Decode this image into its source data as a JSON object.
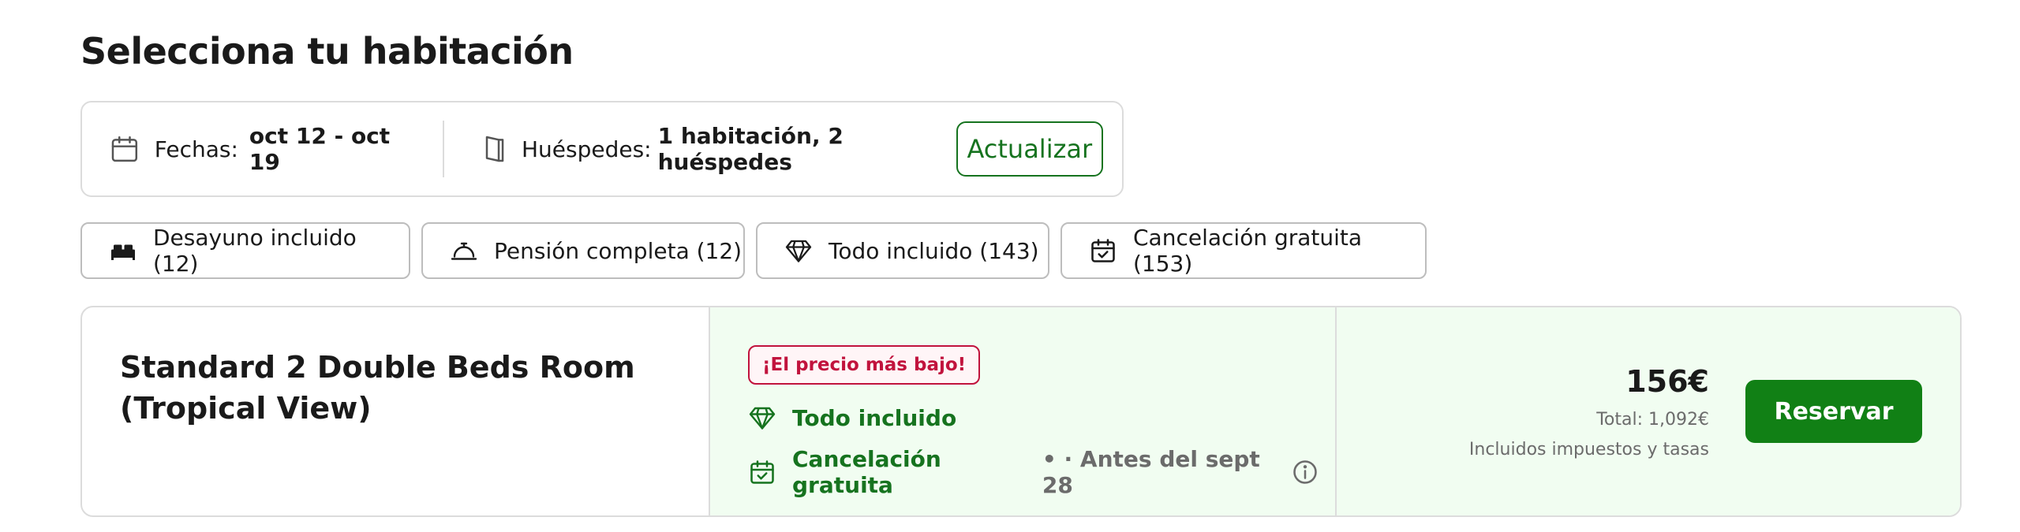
{
  "page": {
    "title": "Selecciona tu habitación"
  },
  "search": {
    "dates_label": "Fechas:",
    "dates_value": "oct 12 - oct 19",
    "guests_label": "Huéspedes:",
    "guests_value": "1 habitación, 2 huéspedes",
    "update_label": "Actualizar"
  },
  "filters": [
    {
      "label": "Desayuno incluido (12)",
      "icon": "bed-icon"
    },
    {
      "label": "Pensión completa (12)",
      "icon": "cloche-icon"
    },
    {
      "label": "Todo incluido (143)",
      "icon": "diamond-icon"
    },
    {
      "label": "Cancelación gratuita (153)",
      "icon": "calendar-check-icon"
    }
  ],
  "room": {
    "name_line1": "Standard 2 Double Beds Room",
    "name_line2": "(Tropical View)",
    "badge": "¡El precio más bajo!",
    "features": {
      "all_inclusive": "Todo incluido",
      "cancellation": "Cancelación gratuita",
      "cancellation_note": "• · Antes del sept 28"
    },
    "price": "156€",
    "total": "Total: 1,092€",
    "taxes": "Incluidos impuestos y tasas",
    "reserve_label": "Reservar"
  },
  "colors": {
    "brand_green": "#118015",
    "badge_red": "#c1133d",
    "highlight_bg": "#f1fdf1"
  }
}
